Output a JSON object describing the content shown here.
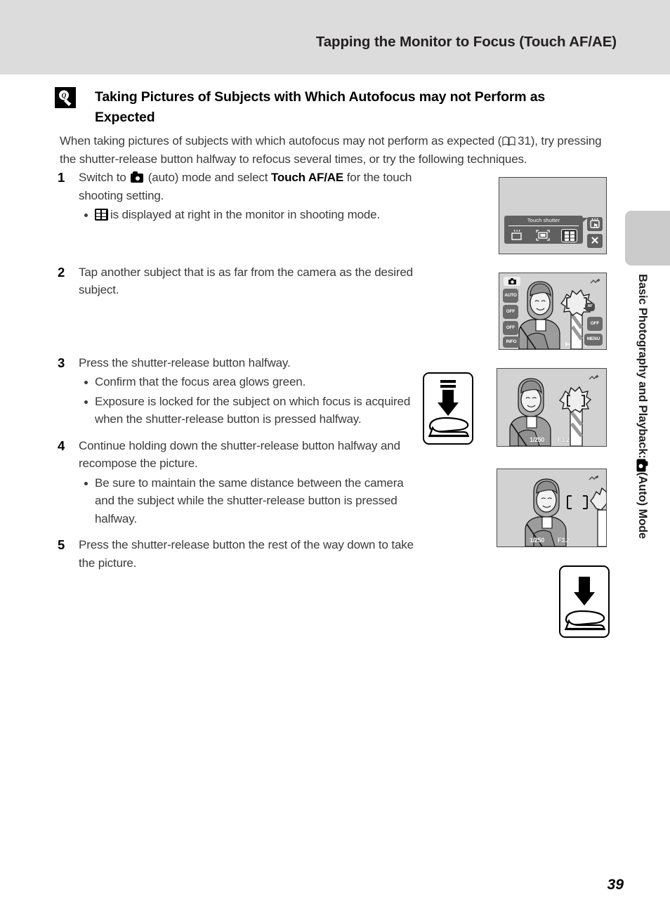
{
  "header": {
    "title": "Tapping the Monitor to Focus (Touch AF/AE)"
  },
  "side_tab": {
    "label_prefix": "Basic Photography and Playback:",
    "label_suffix": "(Auto) Mode",
    "icon": "camera-icon"
  },
  "tip": {
    "icon": "lightbulb-tip-icon",
    "heading": "Taking Pictures of Subjects with Which Autofocus may not Perform as Expected"
  },
  "intro": {
    "text_before_ref": "When taking pictures of subjects with which autofocus may not perform as expected (",
    "ref_icon": "open-book-icon",
    "ref_page": "31",
    "text_after_ref": "), try pressing the shutter-release button halfway to refocus several times, or try the following techniques."
  },
  "steps": [
    {
      "number": "1",
      "text_part1": "Switch to",
      "icon": "camera-icon",
      "text_part2": "(auto) mode and select",
      "bold": "Touch AF/AE",
      "text_part3": "for the touch shooting setting.",
      "bullets": [
        {
          "icon": "touch-afae-icon",
          "text": "is displayed at right in the monitor in shooting mode."
        }
      ]
    },
    {
      "number": "2",
      "text": "Tap another subject that is as far from the camera as the desired subject.",
      "bullets": []
    },
    {
      "number": "3",
      "text": "Press the shutter-release button halfway.",
      "bullets": [
        {
          "text": "Confirm that the focus area glows green."
        },
        {
          "text": "Exposure is locked for the subject on which focus is acquired when the shutter-release button is pressed halfway."
        }
      ]
    },
    {
      "number": "4",
      "text": "Continue holding down the shutter-release button halfway and recompose the picture.",
      "bullets": [
        {
          "text": "Be sure to maintain the same distance between the camera and the subject while the shutter-release button is pressed halfway."
        }
      ]
    },
    {
      "number": "5",
      "text": "Press the shutter-release button the rest of the way down to take the picture.",
      "bullets": []
    }
  ],
  "figures": {
    "fig1": {
      "name": "touch-shutter-menu-screen",
      "panel_title": "Touch shutter",
      "options": [
        "touch-shutter-icon",
        "touch-shooting-icon",
        "touch-afae-icon"
      ],
      "selected_index": 2,
      "side_buttons": [
        "touch-mode-icon",
        "close-icon"
      ]
    },
    "fig2": {
      "name": "shooting-mode-screen",
      "mode_icon": "auto-mode-icon",
      "left_chips": [
        "AUTO",
        "OFF",
        "OFF",
        "INFO"
      ],
      "right_chips": [
        "OFF",
        "MENU"
      ],
      "focus_target_label": "AF",
      "zoom_indicator": "zoom-bar",
      "exposure_icon": "exposure-comp-icon"
    },
    "fig3": {
      "name": "focus-locked-screen",
      "shutter_speed": "1/250",
      "aperture": "F3.2",
      "exposure_icon": "exposure-comp-icon"
    },
    "fig4": {
      "name": "recomposed-screen",
      "shutter_speed": "1/250",
      "aperture": "F3.2",
      "exposure_icon": "exposure-comp-icon"
    },
    "press_halfway": {
      "name": "press-shutter-halfway-diagram",
      "icon": "down-arrow-halfway-icon"
    },
    "press_full": {
      "name": "press-shutter-full-diagram",
      "icon": "down-arrow-full-icon"
    }
  },
  "footer": {
    "page_number": "39"
  }
}
